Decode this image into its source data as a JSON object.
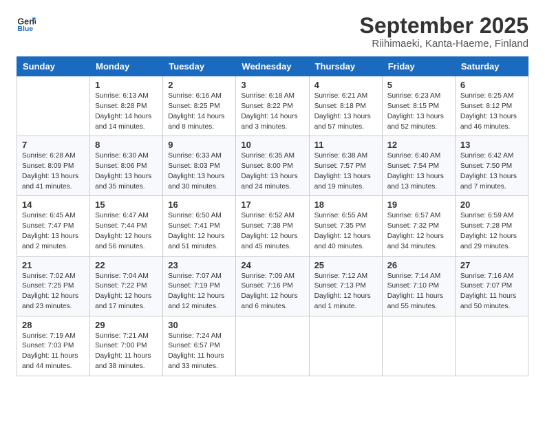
{
  "header": {
    "logo_general": "General",
    "logo_blue": "Blue",
    "title": "September 2025",
    "location": "Riihimaeki, Kanta-Haeme, Finland"
  },
  "weekdays": [
    "Sunday",
    "Monday",
    "Tuesday",
    "Wednesday",
    "Thursday",
    "Friday",
    "Saturday"
  ],
  "weeks": [
    [
      {
        "day": "",
        "info": ""
      },
      {
        "day": "1",
        "info": "Sunrise: 6:13 AM\nSunset: 8:28 PM\nDaylight: 14 hours\nand 14 minutes."
      },
      {
        "day": "2",
        "info": "Sunrise: 6:16 AM\nSunset: 8:25 PM\nDaylight: 14 hours\nand 8 minutes."
      },
      {
        "day": "3",
        "info": "Sunrise: 6:18 AM\nSunset: 8:22 PM\nDaylight: 14 hours\nand 3 minutes."
      },
      {
        "day": "4",
        "info": "Sunrise: 6:21 AM\nSunset: 8:18 PM\nDaylight: 13 hours\nand 57 minutes."
      },
      {
        "day": "5",
        "info": "Sunrise: 6:23 AM\nSunset: 8:15 PM\nDaylight: 13 hours\nand 52 minutes."
      },
      {
        "day": "6",
        "info": "Sunrise: 6:25 AM\nSunset: 8:12 PM\nDaylight: 13 hours\nand 46 minutes."
      }
    ],
    [
      {
        "day": "7",
        "info": "Sunrise: 6:28 AM\nSunset: 8:09 PM\nDaylight: 13 hours\nand 41 minutes."
      },
      {
        "day": "8",
        "info": "Sunrise: 6:30 AM\nSunset: 8:06 PM\nDaylight: 13 hours\nand 35 minutes."
      },
      {
        "day": "9",
        "info": "Sunrise: 6:33 AM\nSunset: 8:03 PM\nDaylight: 13 hours\nand 30 minutes."
      },
      {
        "day": "10",
        "info": "Sunrise: 6:35 AM\nSunset: 8:00 PM\nDaylight: 13 hours\nand 24 minutes."
      },
      {
        "day": "11",
        "info": "Sunrise: 6:38 AM\nSunset: 7:57 PM\nDaylight: 13 hours\nand 19 minutes."
      },
      {
        "day": "12",
        "info": "Sunrise: 6:40 AM\nSunset: 7:54 PM\nDaylight: 13 hours\nand 13 minutes."
      },
      {
        "day": "13",
        "info": "Sunrise: 6:42 AM\nSunset: 7:50 PM\nDaylight: 13 hours\nand 7 minutes."
      }
    ],
    [
      {
        "day": "14",
        "info": "Sunrise: 6:45 AM\nSunset: 7:47 PM\nDaylight: 13 hours\nand 2 minutes."
      },
      {
        "day": "15",
        "info": "Sunrise: 6:47 AM\nSunset: 7:44 PM\nDaylight: 12 hours\nand 56 minutes."
      },
      {
        "day": "16",
        "info": "Sunrise: 6:50 AM\nSunset: 7:41 PM\nDaylight: 12 hours\nand 51 minutes."
      },
      {
        "day": "17",
        "info": "Sunrise: 6:52 AM\nSunset: 7:38 PM\nDaylight: 12 hours\nand 45 minutes."
      },
      {
        "day": "18",
        "info": "Sunrise: 6:55 AM\nSunset: 7:35 PM\nDaylight: 12 hours\nand 40 minutes."
      },
      {
        "day": "19",
        "info": "Sunrise: 6:57 AM\nSunset: 7:32 PM\nDaylight: 12 hours\nand 34 minutes."
      },
      {
        "day": "20",
        "info": "Sunrise: 6:59 AM\nSunset: 7:28 PM\nDaylight: 12 hours\nand 29 minutes."
      }
    ],
    [
      {
        "day": "21",
        "info": "Sunrise: 7:02 AM\nSunset: 7:25 PM\nDaylight: 12 hours\nand 23 minutes."
      },
      {
        "day": "22",
        "info": "Sunrise: 7:04 AM\nSunset: 7:22 PM\nDaylight: 12 hours\nand 17 minutes."
      },
      {
        "day": "23",
        "info": "Sunrise: 7:07 AM\nSunset: 7:19 PM\nDaylight: 12 hours\nand 12 minutes."
      },
      {
        "day": "24",
        "info": "Sunrise: 7:09 AM\nSunset: 7:16 PM\nDaylight: 12 hours\nand 6 minutes."
      },
      {
        "day": "25",
        "info": "Sunrise: 7:12 AM\nSunset: 7:13 PM\nDaylight: 12 hours\nand 1 minute."
      },
      {
        "day": "26",
        "info": "Sunrise: 7:14 AM\nSunset: 7:10 PM\nDaylight: 11 hours\nand 55 minutes."
      },
      {
        "day": "27",
        "info": "Sunrise: 7:16 AM\nSunset: 7:07 PM\nDaylight: 11 hours\nand 50 minutes."
      }
    ],
    [
      {
        "day": "28",
        "info": "Sunrise: 7:19 AM\nSunset: 7:03 PM\nDaylight: 11 hours\nand 44 minutes."
      },
      {
        "day": "29",
        "info": "Sunrise: 7:21 AM\nSunset: 7:00 PM\nDaylight: 11 hours\nand 38 minutes."
      },
      {
        "day": "30",
        "info": "Sunrise: 7:24 AM\nSunset: 6:57 PM\nDaylight: 11 hours\nand 33 minutes."
      },
      {
        "day": "",
        "info": ""
      },
      {
        "day": "",
        "info": ""
      },
      {
        "day": "",
        "info": ""
      },
      {
        "day": "",
        "info": ""
      }
    ]
  ]
}
